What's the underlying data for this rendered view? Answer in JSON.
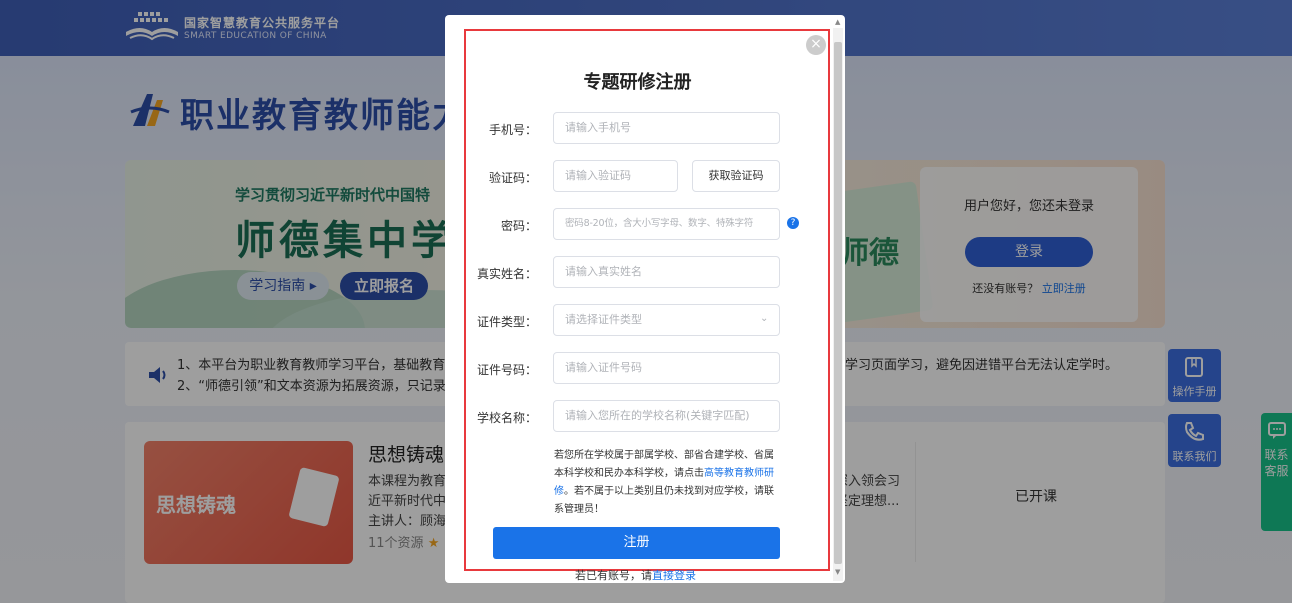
{
  "header": {
    "logo_cn": "国家智慧教育公共服务平台",
    "logo_en": "SMART EDUCATION OF CHINA"
  },
  "page_title": "职业教育教师能力",
  "banner": {
    "subtitle": "学习贯彻习近平新时代中国特",
    "main_text": "师德集中学",
    "guide_button": "学习指南 ▸",
    "signup_button": "立即报名",
    "book_text": "师德"
  },
  "login_card": {
    "hello": "用户您好，您还未登录",
    "login_button": "登录",
    "no_account": "还没有账号？",
    "register_link": "立即注册"
  },
  "notice": {
    "line1": "1、本平台为职业教育教师学习平台，基础教育、",
    "line2": "2、“师德引领”和文本资源为拓展资源，只记录",
    "right": "学习页面学习，避免因进错平台无法认定学时。"
  },
  "course": {
    "image_text": "思想铸魂",
    "name": "思想铸魂",
    "desc1": "本课程为教育",
    "desc2": "近平新时代中",
    "lecturer": "主讲人：顾海",
    "resources": "11个资源",
    "right1": "深入领会习",
    "right2": "坚定理想...",
    "status": "已开课"
  },
  "side": {
    "manual": "操作手册",
    "contact": "联系我们",
    "service": "联系客服"
  },
  "modal": {
    "close": "×",
    "title": "专题研修注册",
    "fields": {
      "phone": {
        "label": "手机号：",
        "placeholder": "请输入手机号"
      },
      "code": {
        "label": "验证码：",
        "placeholder": "请输入验证码",
        "button": "获取验证码"
      },
      "password": {
        "label": "密码：",
        "placeholder": "密码8-20位，含大小写字母、数字、特殊字符",
        "help": "?"
      },
      "realname": {
        "label": "真实姓名：",
        "placeholder": "请输入真实姓名"
      },
      "idtype": {
        "label": "证件类型：",
        "placeholder": "请选择证件类型"
      },
      "idnum": {
        "label": "证件号码：",
        "placeholder": "请输入证件号码"
      },
      "school": {
        "label": "学校名称：",
        "placeholder": "请输入您所在的学校名称(关键字匹配)"
      }
    },
    "note_before": "若您所在学校属于部属学校、部省合建学校、省属本科学校和民办本科学校，请点击",
    "note_link": "高等教育教师研修",
    "note_after": "。若不属于以上类别且仍未找到对应学校，请联系管理员！",
    "submit": "注册",
    "bottom_text": "若已有账号，请",
    "bottom_link": "直接登录"
  }
}
